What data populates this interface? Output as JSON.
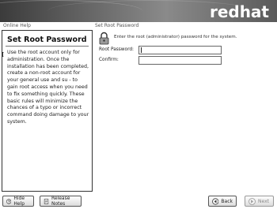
{
  "banner": {
    "logo": "redhat"
  },
  "help": {
    "header": "Online Help",
    "title": "Set Root Password",
    "body": "Use the root account only for administration. Once the installation has been completed, create a non-root account for your general use and su - to gain root access when you need to fix something quickly. These basic rules will minimize the chances of a typo or incorrect command doing damage to your system."
  },
  "main": {
    "header": "Set Root Password",
    "prompt": "Enter the root (administrator) password for the system.",
    "fields": [
      {
        "label": "Root Password:",
        "value": ""
      },
      {
        "label": "Confirm:",
        "value": ""
      }
    ]
  },
  "buttons": {
    "hide_help": "Hide Help",
    "release_notes": "Release Notes",
    "back": "Back",
    "next": "Next"
  },
  "icons": {
    "hide_help": "help-icon",
    "release_notes": "notes-icon",
    "back": "back-arrow-icon",
    "next": "next-arrow-icon",
    "lock": "lock-icon"
  }
}
